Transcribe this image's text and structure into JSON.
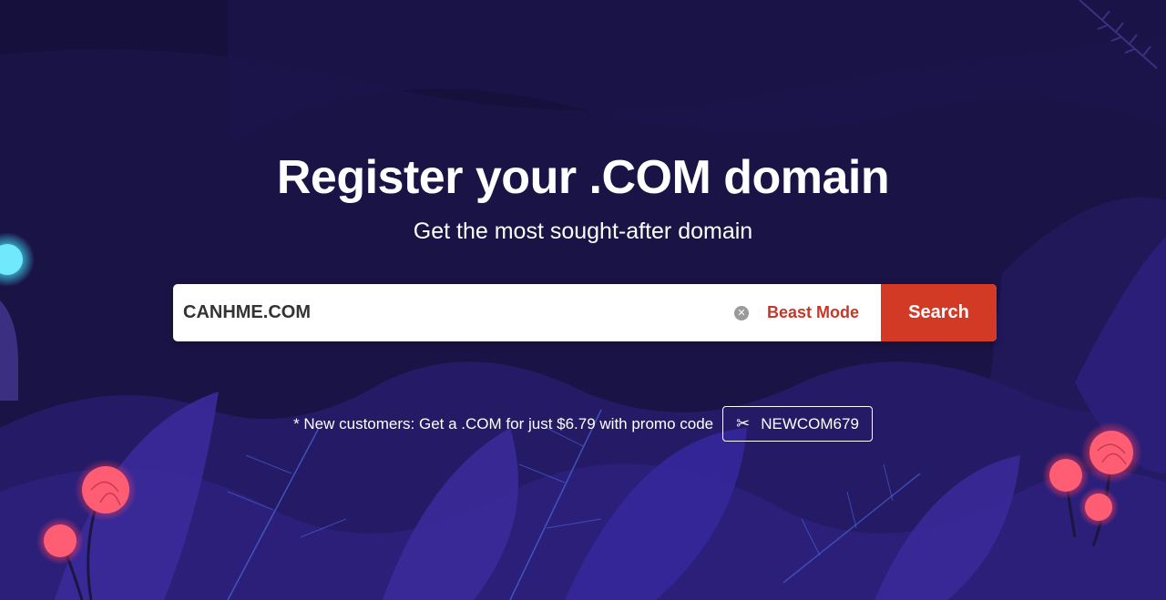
{
  "hero": {
    "title": "Register your .COM domain",
    "subtitle": "Get the most sought-after domain"
  },
  "search": {
    "value": "CANHME.COM",
    "clear_icon": "clear-icon",
    "beast_mode_label": "Beast Mode",
    "button_label": "Search"
  },
  "promo": {
    "text": "* New customers: Get a .COM for just $6.79 with promo code",
    "code": "NEWCOM679",
    "icon": "scissors-icon"
  },
  "colors": {
    "background": "#1a1345",
    "accent": "#d23a25",
    "beast_mode": "#c6372a"
  }
}
